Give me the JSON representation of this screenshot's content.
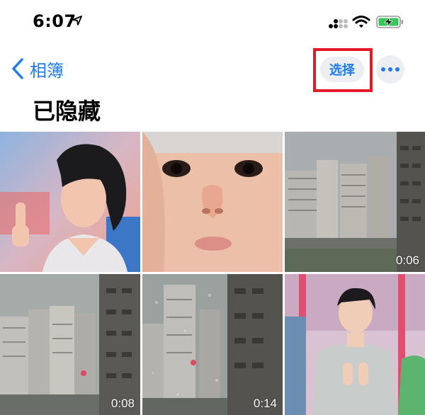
{
  "status_bar": {
    "time": "6:07"
  },
  "nav": {
    "back_label": "相簿",
    "select_label": "选择"
  },
  "title": "已隐藏",
  "grid": {
    "items": [
      {
        "kind": "photo",
        "duration": ""
      },
      {
        "kind": "photo",
        "duration": ""
      },
      {
        "kind": "video",
        "duration": "0:06"
      },
      {
        "kind": "video",
        "duration": "0:08"
      },
      {
        "kind": "video",
        "duration": "0:14"
      },
      {
        "kind": "photo",
        "duration": ""
      }
    ]
  },
  "colors": {
    "accent": "#1d7cf2",
    "highlight_border": "#e5182a",
    "battery_green": "#34c759"
  },
  "icons": [
    "location-arrow-icon",
    "cellular-signal-icon",
    "wifi-icon",
    "battery-charging-icon",
    "chevron-left-icon",
    "ellipsis-icon",
    "video-thumbnail"
  ]
}
